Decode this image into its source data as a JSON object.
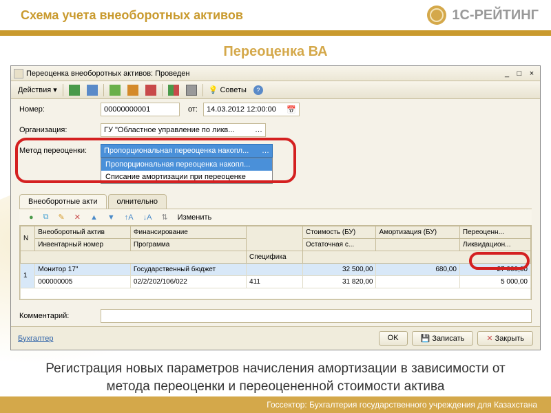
{
  "slide": {
    "title": "Схема учета внеоборотных активов",
    "brand": "1С-РЕЙТИНГ",
    "section": "Переоценка ВА",
    "caption": "Регистрация новых параметров начисления амортизации в зависимости от метода переоценки и переоцененной стоимости актива",
    "footer": "Госсектор: Бухгалтерия государственного учреждения для Казахстана"
  },
  "window": {
    "title": "Переоценка внеоборотных активов: Проведен"
  },
  "toolbar": {
    "actions": "Действия",
    "tips": "Советы"
  },
  "fields": {
    "number_label": "Номер:",
    "number_value": "00000000001",
    "date_label": "от:",
    "date_value": "14.03.2012 12:00:00",
    "org_label": "Организация:",
    "org_value": "ГУ \"Областное управление по ликв...",
    "method_label": "Метод переоценки:",
    "method_value": "Пропорциональная переоценка накопл..."
  },
  "dropdown": {
    "opt1": "Пропорциональная переоценка накопл...",
    "opt2": "Списание амортизации при переоценке"
  },
  "tabs": {
    "t1": "Внеоборотные акти",
    "t2": "олнительно"
  },
  "grid_toolbar": {
    "change": "Изменить"
  },
  "grid": {
    "h_n": "N",
    "h_asset": "Внеоборотный актив",
    "h_inv": "Инвентарный номер",
    "h_fin": "Финансирование",
    "h_prog": "Программа",
    "h_spec": "Специфика",
    "h_cost": "Стоимость (БУ)",
    "h_rest": "Остаточная с...",
    "h_amort": "Амортизация (БУ)",
    "h_reval": "Переоценн...",
    "h_liq": "Ликвидацион...",
    "r1_n": "1",
    "r1_asset": "Монитор 17\"",
    "r1_inv": "000000005",
    "r1_fin": "Государственный бюджет",
    "r1_prog": "02/2/202/106/022",
    "r1_spec": "411",
    "r1_cost": "32 500,00",
    "r1_rest": "31 820,00",
    "r1_amort": "680,00",
    "r1_reval": "27 000,00",
    "r1_liq": "5 000,00"
  },
  "comment": {
    "label": "Комментарий:"
  },
  "bottom": {
    "user": "Бухгалтер",
    "ok": "OK",
    "save": "Записать",
    "close": "Закрыть"
  }
}
